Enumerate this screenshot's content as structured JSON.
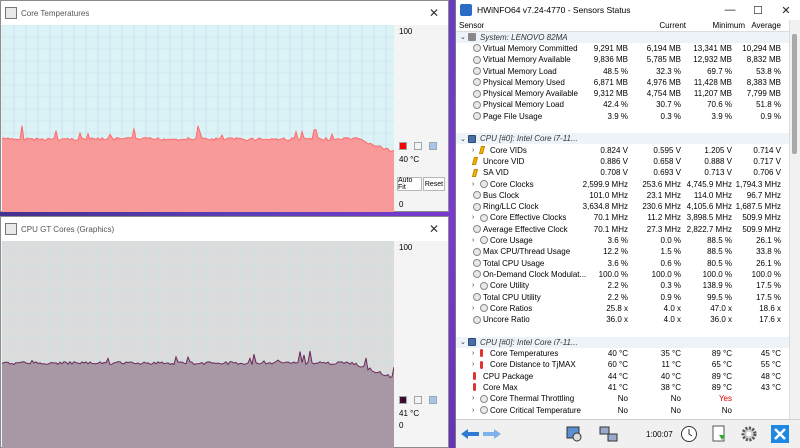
{
  "core_temp_window": {
    "title": "Core Temperatures",
    "scale_max": "100",
    "scale_min": "0",
    "current_value": "40 °C",
    "series_colors": [
      "#ff0000",
      "#dddddd",
      "#a8c4e8"
    ],
    "fill_color": "#f89a9a",
    "line_color": "#ff6a6a",
    "buttons": {
      "auto_fit": "Auto Fit",
      "reset": "Reset"
    },
    "level_fraction": 0.39
  },
  "gpu_window": {
    "title": "CPU GT Cores (Graphics)",
    "scale_max": "100",
    "scale_min": "0",
    "current_value": "41 °C",
    "series_colors": [
      "#400a2a",
      "#dddddd",
      "#a8c4e8"
    ],
    "fill_color": "#a898a6",
    "line_color": "#6a2a58",
    "buttons": {
      "auto_fit": "Auto Fit",
      "reset": "Reset"
    },
    "level_fraction": 0.41
  },
  "sensors": {
    "title": "HWiNFO64 v7.24-4770 - Sensors Status",
    "window_buttons": [
      "—",
      "☐",
      "✕"
    ],
    "columns": {
      "sensor": "Sensor",
      "current": "Current",
      "minimum": "Minimum",
      "maximum": "Maximum",
      "average": "Average"
    },
    "rows": [
      {
        "type": "group",
        "name": "System: LENOVO 82MA",
        "icon": "sys"
      },
      {
        "name": "Virtual Memory Committed",
        "cur": "9,291 MB",
        "min": "6,194 MB",
        "max": "13,341 MB",
        "avg": "10,294 MB",
        "icon": "circle"
      },
      {
        "name": "Virtual Memory Available",
        "cur": "9,836 MB",
        "min": "5,785 MB",
        "max": "12,932 MB",
        "avg": "8,832 MB",
        "icon": "circle"
      },
      {
        "name": "Virtual Memory Load",
        "cur": "48.5 %",
        "min": "32.3 %",
        "max": "69.7 %",
        "avg": "53.8 %",
        "icon": "circle"
      },
      {
        "name": "Physical Memory Used",
        "cur": "6,871 MB",
        "min": "4,976 MB",
        "max": "11,428 MB",
        "avg": "8,383 MB",
        "icon": "circle"
      },
      {
        "name": "Physical Memory Available",
        "cur": "9,312 MB",
        "min": "4,754 MB",
        "max": "11,207 MB",
        "avg": "7,799 MB",
        "icon": "circle"
      },
      {
        "name": "Physical Memory Load",
        "cur": "42.4 %",
        "min": "30.7 %",
        "max": "70.6 %",
        "avg": "51.8 %",
        "icon": "circle"
      },
      {
        "name": "Page File Usage",
        "cur": "3.9 %",
        "min": "0.3 %",
        "max": "3.9 %",
        "avg": "0.9 %",
        "icon": "circle"
      },
      {
        "type": "spacer"
      },
      {
        "type": "group",
        "name": "CPU [#0]: Intel Core i7-11...",
        "icon": "cpu"
      },
      {
        "name": "Core VIDs",
        "cur": "0.824 V",
        "min": "0.595 V",
        "max": "1.205 V",
        "avg": "0.714 V",
        "icon": "volt",
        "expand": true
      },
      {
        "name": "Uncore VID",
        "cur": "0.886 V",
        "min": "0.658 V",
        "max": "0.888 V",
        "avg": "0.717 V",
        "icon": "volt"
      },
      {
        "name": "SA VID",
        "cur": "0.708 V",
        "min": "0.693 V",
        "max": "0.713 V",
        "avg": "0.706 V",
        "icon": "volt"
      },
      {
        "name": "Core Clocks",
        "cur": "2,599.9 MHz",
        "min": "253.6 MHz",
        "max": "4,745.9 MHz",
        "avg": "1,794.3 MHz",
        "icon": "circle",
        "expand": true
      },
      {
        "name": "Bus Clock",
        "cur": "101.0 MHz",
        "min": "23.1 MHz",
        "max": "114.0 MHz",
        "avg": "96.7 MHz",
        "icon": "circle"
      },
      {
        "name": "Ring/LLC Clock",
        "cur": "3,634.8 MHz",
        "min": "230.6 MHz",
        "max": "4,105.6 MHz",
        "avg": "1,687.5 MHz",
        "icon": "circle"
      },
      {
        "name": "Core Effective Clocks",
        "cur": "70.1 MHz",
        "min": "11.2 MHz",
        "max": "3,898.5 MHz",
        "avg": "509.9 MHz",
        "icon": "circle",
        "expand": true
      },
      {
        "name": "Average Effective Clock",
        "cur": "70.1 MHz",
        "min": "27.3 MHz",
        "max": "2,822.7 MHz",
        "avg": "509.9 MHz",
        "icon": "circle"
      },
      {
        "name": "Core Usage",
        "cur": "3.6 %",
        "min": "0.0 %",
        "max": "88.5 %",
        "avg": "26.1 %",
        "icon": "circle",
        "expand": true
      },
      {
        "name": "Max CPU/Thread Usage",
        "cur": "12.2 %",
        "min": "1.5 %",
        "max": "88.5 %",
        "avg": "33.8 %",
        "icon": "circle"
      },
      {
        "name": "Total CPU Usage",
        "cur": "3.6 %",
        "min": "0.6 %",
        "max": "80.5 %",
        "avg": "26.1 %",
        "icon": "circle"
      },
      {
        "name": "On-Demand Clock Modulat...",
        "cur": "100.0 %",
        "min": "100.0 %",
        "max": "100.0 %",
        "avg": "100.0 %",
        "icon": "circle"
      },
      {
        "name": "Core Utility",
        "cur": "2.2 %",
        "min": "0.3 %",
        "max": "138.9 %",
        "avg": "17.5 %",
        "icon": "circle",
        "expand": true
      },
      {
        "name": "Total CPU Utility",
        "cur": "2.2 %",
        "min": "0.9 %",
        "max": "99.5 %",
        "avg": "17.5 %",
        "icon": "circle"
      },
      {
        "name": "Core Ratios",
        "cur": "25.8 x",
        "min": "4.0 x",
        "max": "47.0 x",
        "avg": "18.6 x",
        "icon": "circle",
        "expand": true
      },
      {
        "name": "Uncore Ratio",
        "cur": "36.0 x",
        "min": "4.0 x",
        "max": "36.0 x",
        "avg": "17.6 x",
        "icon": "circle"
      },
      {
        "type": "spacer"
      },
      {
        "type": "group",
        "name": "CPU [#0]: Intel Core i7-11...",
        "icon": "cpu"
      },
      {
        "name": "Core Temperatures",
        "cur": "40 °C",
        "min": "35 °C",
        "max": "89 °C",
        "avg": "45 °C",
        "icon": "temp",
        "expand": true
      },
      {
        "name": "Core Distance to TjMAX",
        "cur": "60 °C",
        "min": "11 °C",
        "max": "65 °C",
        "avg": "55 °C",
        "icon": "temp",
        "expand": true
      },
      {
        "name": "CPU Package",
        "cur": "44 °C",
        "min": "40 °C",
        "max": "89 °C",
        "avg": "48 °C",
        "icon": "temp"
      },
      {
        "name": "Core Max",
        "cur": "41 °C",
        "min": "38 °C",
        "max": "89 °C",
        "avg": "43 °C",
        "icon": "temp"
      },
      {
        "name": "Core Thermal Throttling",
        "cur": "No",
        "min": "No",
        "max": "Yes",
        "avg": "",
        "icon": "circle",
        "expand": true,
        "max_red": true
      },
      {
        "name": "Core Critical Temperature",
        "cur": "No",
        "min": "No",
        "max": "No",
        "avg": "",
        "icon": "circle",
        "expand": true
      }
    ],
    "clock": "1:00:07"
  }
}
